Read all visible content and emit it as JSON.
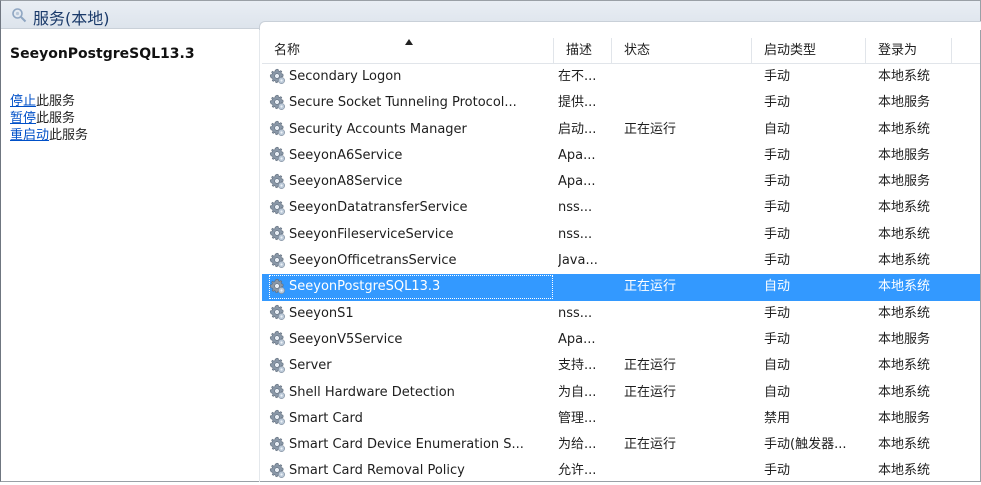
{
  "title": "服务(本地)",
  "left_pane": {
    "service_name": "SeeyonPostgreSQL13.3",
    "actions": [
      {
        "link": "停止",
        "suffix": "此服务"
      },
      {
        "link": "暂停",
        "suffix": "此服务"
      },
      {
        "link": "重启动",
        "suffix": "此服务"
      }
    ]
  },
  "columns": {
    "name": "名称",
    "desc": "描述",
    "status": "状态",
    "startup": "启动类型",
    "logon": "登录为"
  },
  "rows": [
    {
      "name": "Secondary Logon",
      "desc": "在不...",
      "status": "",
      "startup": "手动",
      "logon": "本地系统"
    },
    {
      "name": "Secure Socket Tunneling Protocol...",
      "desc": "提供...",
      "status": "",
      "startup": "手动",
      "logon": "本地服务"
    },
    {
      "name": "Security Accounts Manager",
      "desc": "启动...",
      "status": "正在运行",
      "startup": "自动",
      "logon": "本地系统"
    },
    {
      "name": "SeeyonA6Service",
      "desc": "Apa...",
      "status": "",
      "startup": "手动",
      "logon": "本地服务"
    },
    {
      "name": "SeeyonA8Service",
      "desc": "Apa...",
      "status": "",
      "startup": "手动",
      "logon": "本地服务"
    },
    {
      "name": "SeeyonDatatransferService",
      "desc": "nss...",
      "status": "",
      "startup": "手动",
      "logon": "本地系统"
    },
    {
      "name": "SeeyonFileserviceService",
      "desc": "nss...",
      "status": "",
      "startup": "手动",
      "logon": "本地系统"
    },
    {
      "name": "SeeyonOfficetransService",
      "desc": "Java...",
      "status": "",
      "startup": "手动",
      "logon": "本地系统"
    },
    {
      "name": "SeeyonPostgreSQL13.3",
      "desc": "",
      "status": "正在运行",
      "startup": "自动",
      "logon": "本地系统",
      "selected": true
    },
    {
      "name": "SeeyonS1",
      "desc": "nss...",
      "status": "",
      "startup": "手动",
      "logon": "本地系统"
    },
    {
      "name": "SeeyonV5Service",
      "desc": "Apa...",
      "status": "",
      "startup": "手动",
      "logon": "本地服务"
    },
    {
      "name": "Server",
      "desc": "支持...",
      "status": "正在运行",
      "startup": "自动",
      "logon": "本地系统"
    },
    {
      "name": "Shell Hardware Detection",
      "desc": "为自...",
      "status": "正在运行",
      "startup": "自动",
      "logon": "本地系统"
    },
    {
      "name": "Smart Card",
      "desc": "管理...",
      "status": "",
      "startup": "禁用",
      "logon": "本地服务"
    },
    {
      "name": "Smart Card Device Enumeration S...",
      "desc": "为给...",
      "status": "正在运行",
      "startup": "手动(触发器...",
      "logon": "本地系统"
    },
    {
      "name": "Smart Card Removal Policy",
      "desc": "允许...",
      "status": "",
      "startup": "手动",
      "logon": "本地系统"
    }
  ],
  "colors": {
    "selection": "#3399ff",
    "link": "#0050c8",
    "title_text": "#1a3a6a"
  },
  "icons": {
    "title": "search-services-icon",
    "row": "gear-service-icon",
    "sort": "sort-ascending-arrow"
  }
}
